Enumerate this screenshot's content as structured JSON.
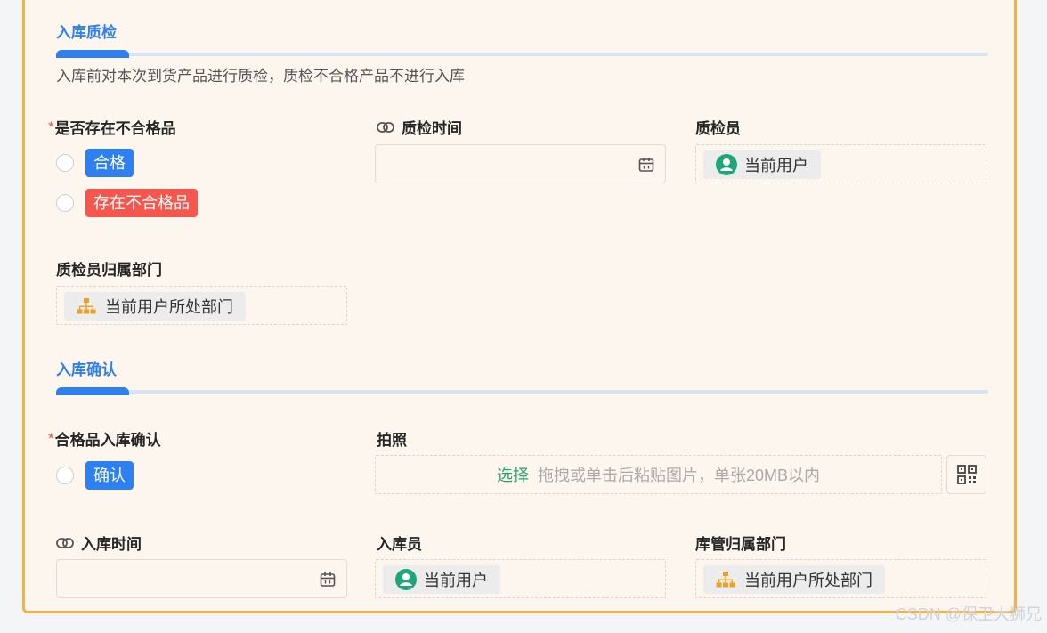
{
  "section1": {
    "title": "入库质检",
    "description": "入库前对本次到货产品进行质检，质检不合格产品不进行入库"
  },
  "fields": {
    "has_unqualified": {
      "required_mark": "*",
      "label": "是否存在不合格品",
      "options": [
        "合格",
        "存在不合格品"
      ]
    },
    "inspection_time": {
      "label": "质检时间"
    },
    "inspector": {
      "label": "质检员",
      "value": "当前用户"
    },
    "inspector_dept": {
      "label": "质检员归属部门",
      "value": "当前用户所处部门"
    }
  },
  "section2": {
    "title": "入库确认"
  },
  "fields2": {
    "qualified_confirm": {
      "required_mark": "*",
      "label": "合格品入库确认",
      "option": "确认"
    },
    "photo": {
      "label": "拍照",
      "select_label": "选择",
      "hint": "拖拽或单击后粘贴图片，单张20MB以内"
    },
    "stock_in_time": {
      "label": "入库时间"
    },
    "stock_in_person": {
      "label": "入库员",
      "value": "当前用户"
    },
    "warehouse_dept": {
      "label": "库管归属部门",
      "value": "当前用户所处部门"
    }
  },
  "watermark": "CSDN @保卫大狮兄",
  "colors": {
    "accent": "#2e7ff0",
    "danger": "#f5574f",
    "card_border": "#f0b24a",
    "card_bg": "#fdf6ee",
    "upload_select": "#2aa16e",
    "user_icon": "#20a57a",
    "org_icon": "#f0a020"
  },
  "icons": [
    "link-icon",
    "calendar-icon",
    "user-icon",
    "org-icon",
    "qrcode-icon"
  ]
}
